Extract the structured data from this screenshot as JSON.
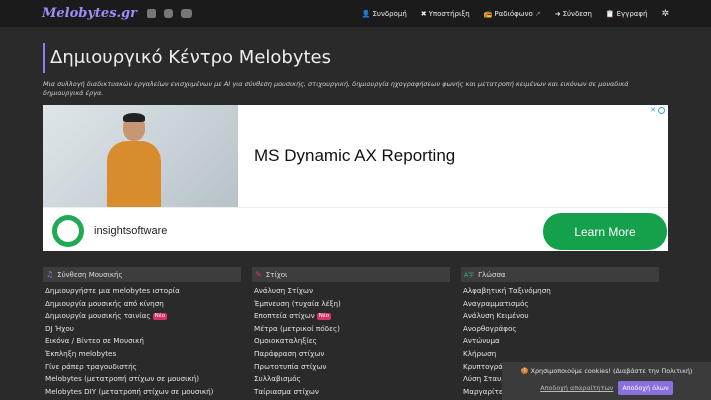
{
  "nav": {
    "logo": "Melobytes.gr",
    "social": [
      "facebook-icon",
      "instagram-icon",
      "youtube-icon"
    ],
    "items": [
      {
        "icon": "👤",
        "label": "Συνδρομή"
      },
      {
        "icon": "✖",
        "label": "Υποστήριξη"
      },
      {
        "icon": "📻",
        "label": "Ραδιόφωνο"
      },
      {
        "icon": "➜",
        "label": "Σύνδεση"
      },
      {
        "icon": "📋",
        "label": "Εγγραφή"
      }
    ],
    "theme_icon": "✲"
  },
  "hero": {
    "title": "Δημιουργικό Κέντρο Melobytes",
    "subtitle": "Μια συλλογή διαδικτυακών εργαλείων ενισχυμένων με AI για σύνθεση μουσικής, στιχουργική, δημιουργία ηχογραφήσεων φωνής και μετατροπή κειμένων και εικόνων σε μοναδικά δημιουργικά έργα."
  },
  "ad": {
    "headline": "MS Dynamic AX Reporting",
    "brand": "insightsoftware",
    "cta": "Learn More",
    "close": "✕"
  },
  "columns": [
    {
      "icon": "♫",
      "title": "Σύνθεση Μουσικής",
      "items": [
        {
          "label": "Δημιουργήστε μια melobytes ιστορία",
          "badge": ""
        },
        {
          "label": "Δημιουργία μουσικής από κίνηση",
          "badge": ""
        },
        {
          "label": "Δημιουργία μουσικής ταινίας",
          "badge": "Νέο"
        },
        {
          "label": "DJ Ήχου",
          "badge": ""
        },
        {
          "label": "Εικόνα / Βίντεο σε Μουσική",
          "badge": ""
        },
        {
          "label": "Έκπληξη melobytes",
          "badge": ""
        },
        {
          "label": "Γίνε ράπερ τραγουδιστής",
          "badge": ""
        },
        {
          "label": "Melobytes (μετατροπή στίχων σε μουσική)",
          "badge": ""
        },
        {
          "label": "Melobytes DIY (μετατροπή στίχων σε μουσική)",
          "badge": ""
        }
      ]
    },
    {
      "icon": "✎",
      "title": "Στίχοι",
      "items": [
        {
          "label": "Ανάλυση Στίχων",
          "badge": ""
        },
        {
          "label": "Έμπνευση (τυχαία λέξη)",
          "badge": ""
        },
        {
          "label": "Εποπτεία στίχων",
          "badge": "Νέο"
        },
        {
          "label": "Μέτρα (μετρικοί πόδες)",
          "badge": ""
        },
        {
          "label": "Ομοιοκαταληξίες",
          "badge": ""
        },
        {
          "label": "Παράφραση στίχων",
          "badge": ""
        },
        {
          "label": "Πρωτοτυπία στίχων",
          "badge": ""
        },
        {
          "label": "Συλλαβισμός",
          "badge": ""
        },
        {
          "label": "Ταίριασμα στίχων",
          "badge": ""
        }
      ]
    },
    {
      "icon": "A字",
      "title": "Γλώσσα",
      "items": [
        {
          "label": "Αλφαβητική Ταξινόμηση",
          "badge": ""
        },
        {
          "label": "Αναγραμματισμός",
          "badge": ""
        },
        {
          "label": "Ανάλυση Κειμένου",
          "badge": ""
        },
        {
          "label": "Ανορθογράφος",
          "badge": ""
        },
        {
          "label": "Αντώνυμα",
          "badge": ""
        },
        {
          "label": "Κλήρωση",
          "badge": ""
        },
        {
          "label": "Κρυπτογράφηση",
          "badge": ""
        },
        {
          "label": "Λύση Σταυρόλεξου",
          "badge": ""
        },
        {
          "label": "Μαργαρίτες",
          "badge": ""
        }
      ]
    }
  ],
  "cookie": {
    "text": "🍪 Χρησιμοποιούμε cookies! (Διαβάστε την Πολιτική)",
    "reject": "Αποδοχή απαραίτητων",
    "accept": "Αποδοχή όλων"
  }
}
